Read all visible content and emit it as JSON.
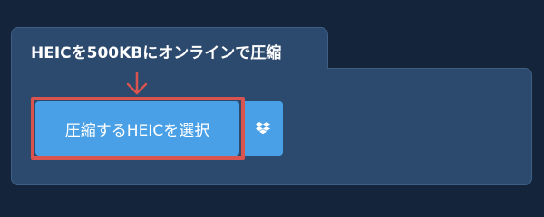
{
  "panel": {
    "title": "HEICを500KBにオンラインで圧縮"
  },
  "upload": {
    "select_button_label": "圧縮するHEICを選択",
    "dropbox_icon": "dropbox-icon"
  },
  "annotation": {
    "arrow_icon": "down-arrow-icon",
    "highlight_color": "#d9534f"
  },
  "colors": {
    "background": "#14243a",
    "panel": "#2c4a6e",
    "button": "#4aa0e6"
  }
}
